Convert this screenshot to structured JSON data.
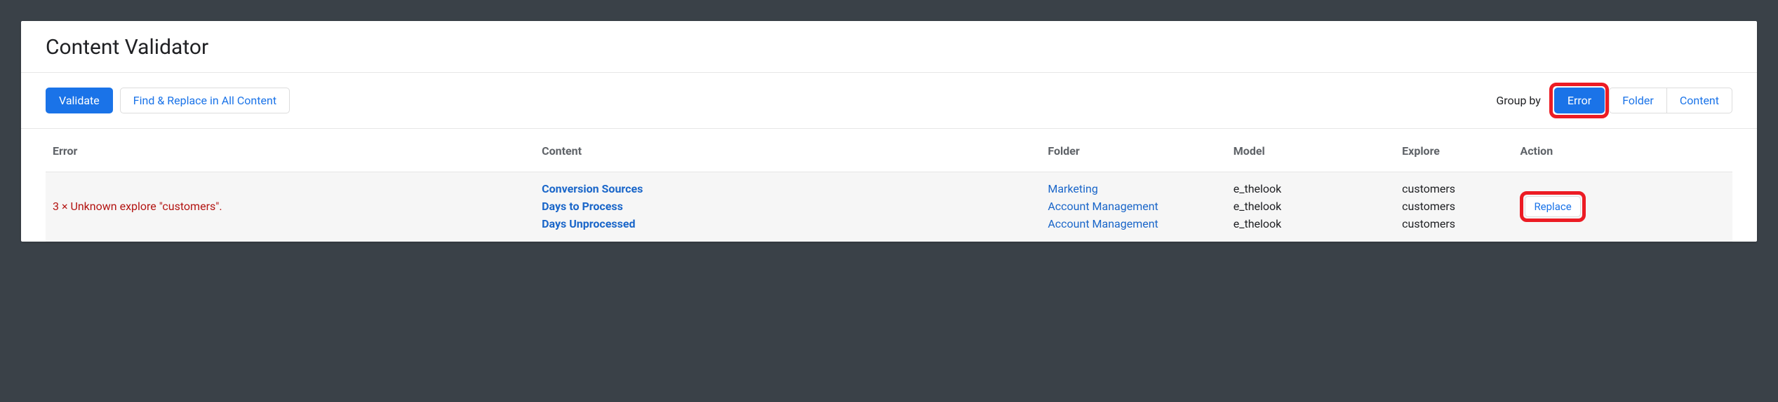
{
  "header": {
    "title": "Content Validator"
  },
  "toolbar": {
    "validate_label": "Validate",
    "find_replace_label": "Find & Replace in All Content",
    "group_by_label": "Group by",
    "group_options": {
      "error": "Error",
      "folder": "Folder",
      "content": "Content"
    }
  },
  "table": {
    "headers": {
      "error": "Error",
      "content": "Content",
      "folder": "Folder",
      "model": "Model",
      "explore": "Explore",
      "action": "Action"
    },
    "row": {
      "error_text": "3 × Unknown explore \"customers\".",
      "items": [
        {
          "content": "Conversion Sources",
          "folder": "Marketing",
          "model": "e_thelook",
          "explore": "customers"
        },
        {
          "content": "Days to Process",
          "folder": "Account Management",
          "model": "e_thelook",
          "explore": "customers"
        },
        {
          "content": "Days Unprocessed",
          "folder": "Account Management",
          "model": "e_thelook",
          "explore": "customers"
        }
      ],
      "action_label": "Replace"
    }
  }
}
